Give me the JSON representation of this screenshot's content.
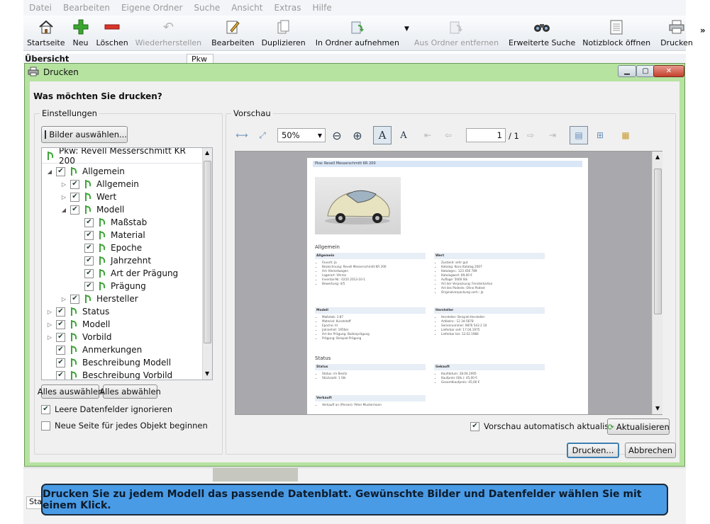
{
  "menubar": {
    "items": [
      "Datei",
      "Bearbeiten",
      "Eigene Ordner",
      "Suche",
      "Ansicht",
      "Extras",
      "Hilfe"
    ]
  },
  "toolbar": {
    "startseite": "Startseite",
    "neu": "Neu",
    "loeschen": "Löschen",
    "wiederherstellen": "Wiederherstellen",
    "bearbeiten": "Bearbeiten",
    "duplizieren": "Duplizieren",
    "in_ordner": "In Ordner aufnehmen",
    "aus_ordner": "Aus Ordner entfernen",
    "erweiterte_suche": "Erweiterte Suche",
    "notizblock": "Notizblock öffnen",
    "drucken": "Drucken",
    "more": "»"
  },
  "background": {
    "overview": "Übersicht",
    "tab_pkw": "Pkw",
    "status_stub": "Sta"
  },
  "dialog": {
    "title": "Drucken",
    "question": "Was möchten Sie drucken?",
    "settings_title": "Einstellungen",
    "select_images_button": "Bilder auswählen...",
    "tree_root": "Pkw: Revell Messerschmitt KR 200",
    "tree_items": [
      {
        "label": "Allgemein",
        "depth": 0,
        "toggle": "◢",
        "checked": true
      },
      {
        "label": "Allgemein",
        "depth": 1,
        "toggle": "▷",
        "checked": true
      },
      {
        "label": "Wert",
        "depth": 1,
        "toggle": "▷",
        "checked": true
      },
      {
        "label": "Modell",
        "depth": 1,
        "toggle": "◢",
        "checked": true
      },
      {
        "label": "Maßstab",
        "depth": 2,
        "toggle": "",
        "checked": true
      },
      {
        "label": "Material",
        "depth": 2,
        "toggle": "",
        "checked": true
      },
      {
        "label": "Epoche",
        "depth": 2,
        "toggle": "",
        "checked": true
      },
      {
        "label": "Jahrzehnt",
        "depth": 2,
        "toggle": "",
        "checked": true
      },
      {
        "label": "Art der Prägung",
        "depth": 2,
        "toggle": "",
        "checked": true
      },
      {
        "label": "Prägung",
        "depth": 2,
        "toggle": "",
        "checked": true
      },
      {
        "label": "Hersteller",
        "depth": 1,
        "toggle": "▷",
        "checked": true
      },
      {
        "label": "Status",
        "depth": 0,
        "toggle": "▷",
        "checked": true
      },
      {
        "label": "Modell",
        "depth": 0,
        "toggle": "▷",
        "checked": true
      },
      {
        "label": "Vorbild",
        "depth": 0,
        "toggle": "▷",
        "checked": true
      },
      {
        "label": "Anmerkungen",
        "depth": 0,
        "toggle": "",
        "checked": true
      },
      {
        "label": "Beschreibung Modell",
        "depth": 0,
        "toggle": "",
        "checked": true
      },
      {
        "label": "Beschreibung Vorbild",
        "depth": 0,
        "toggle": "",
        "checked": true
      }
    ],
    "select_all": "Alles auswählen",
    "deselect_all": "Alles abwählen",
    "ignore_empty_label": "Leere Datenfelder ignorieren",
    "ignore_empty_checked": true,
    "new_page_label": "Neue Seite für jedes Objekt beginnen",
    "new_page_checked": false,
    "preview_title": "Vorschau",
    "zoom": "50%",
    "page_current": "1",
    "page_total": "/ 1",
    "auto_refresh_label": "Vorschau automatisch aktualisieren",
    "auto_refresh_checked": true,
    "refresh_button": "Aktualisieren",
    "print_button": "Drucken...",
    "cancel_button": "Abbrechen"
  },
  "preview_page": {
    "header": "Pkw: Revell Messerschmitt KR 200",
    "section_allgemein": "Allgemein",
    "box_allgemein": {
      "title": "Allgemein",
      "lines": [
        "Favorit: Ja",
        "Bezeichnung: Revell Messerschmitt KR 200",
        "Art: Kleinstwagen",
        "Lagerort: Vitrine",
        "Inventar-Nr.: 0210 2013-10-1",
        "Bewertung: 4/5"
      ]
    },
    "box_wert": {
      "title": "Wert",
      "lines": [
        "Zustand: sehr gut",
        "Katalog: Koco Katalog 2007",
        "Katalognr.: 123 456 789",
        "Katalogwert: 89,00 €",
        "Auflage: 5000 Stk",
        "Art der Verpackung: Fensterkarton",
        "Art des Podests: Ohne Podest",
        "Originalverpackung vorh.: Ja"
      ]
    },
    "box_modell": {
      "title": "Modell",
      "lines": [
        "Maßstab: 1:87",
        "Material: Kunststoff",
        "Epoche: III",
        "Jahrzehnt: 1950er",
        "Art der Prägung: Bodenprägung",
        "Prägung: Beispiel-Prägung"
      ]
    },
    "box_hersteller": {
      "title": "Hersteller",
      "lines": [
        "Hersteller: Beispiel-Hersteller",
        "Artikelnr.: 12 34-5678",
        "Seriennummer: 9876 543 2 10",
        "Lieferbar seit: 17.04.1975",
        "Lieferbar bis: 12.02.1984"
      ]
    },
    "section_status": "Status",
    "box_status": {
      "title": "Status",
      "lines": [
        "Status: im Besitz",
        "Stückzahl: 1 Stk"
      ]
    },
    "box_gekauft": {
      "title": "Gekauft",
      "lines": [
        "Kaufdatum: 28.04.2005",
        "Kaufpreis (Stk.): 45,00 €",
        "Gesamtkaufpreis: 45,00 €"
      ]
    },
    "box_verkauft": {
      "title": "Verkauft",
      "lines": [
        "Verkauft an (Person): Peter Mustermann"
      ]
    }
  },
  "banner": {
    "text": "Drucken Sie zu jedem Modell das passende Datenblatt. Gewünschte Bilder und Datenfelder wählen Sie mit einem Klick."
  }
}
